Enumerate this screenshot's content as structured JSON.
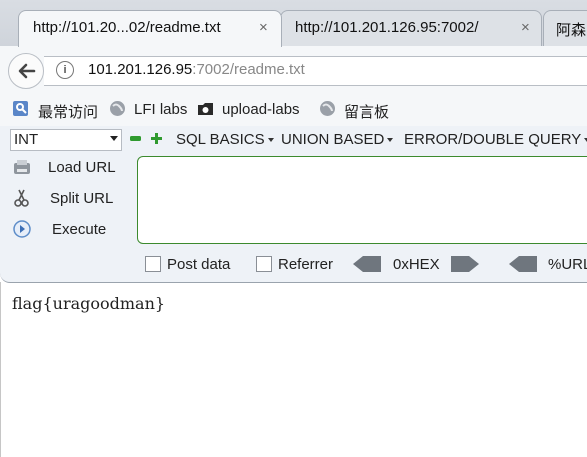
{
  "tabs": [
    {
      "title": "http://101.20...02/readme.txt",
      "close": "×",
      "active": true
    },
    {
      "title": "http://101.201.126.95:7002/",
      "close": "×",
      "active": false
    },
    {
      "title": "阿森",
      "active": false
    }
  ],
  "address": {
    "host": "101.201.126.95",
    "rest": ":7002/readme.txt"
  },
  "bookmarks": [
    {
      "label": "最常访问",
      "icon": "most-visited-icon"
    },
    {
      "label": "LFI labs",
      "icon": "globe-icon"
    },
    {
      "label": "upload-labs",
      "icon": "folder-icon"
    },
    {
      "label": "留言板",
      "icon": "globe-icon"
    }
  ],
  "hackbar": {
    "select_value": "INT",
    "menus": [
      "SQL BASICS",
      "UNION BASED",
      "ERROR/DOUBLE QUERY"
    ],
    "buttons": {
      "load": "Load URL",
      "split": "Split URL",
      "execute": "Execute"
    },
    "post_data": "Post data",
    "referrer": "Referrer",
    "hex": "0xHEX",
    "url": "%URL"
  },
  "page": {
    "content": "flag{uragoodman}"
  },
  "colors": {
    "accent_green": "#2f9a2f",
    "textarea_border": "#3c8a2e"
  }
}
